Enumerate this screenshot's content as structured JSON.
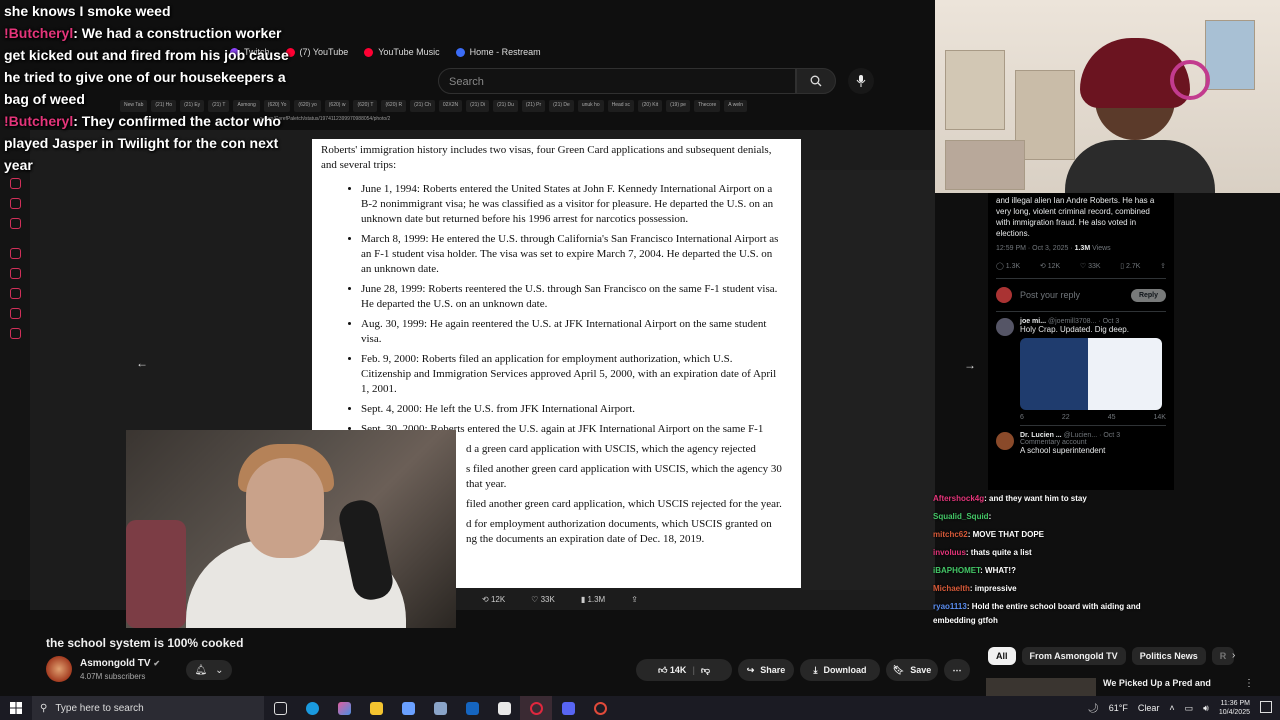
{
  "bookmarks": [
    {
      "label": "Twitch",
      "color": "#9146ff"
    },
    {
      "label": "(7) YouTube",
      "color": "#ff0033"
    },
    {
      "label": "YouTube Music",
      "color": "#ff0033"
    },
    {
      "label": "Home - Restream",
      "color": "#3b6cf6"
    }
  ],
  "search": {
    "placeholder": "Search"
  },
  "browser_tabs": [
    "New Tab",
    "(21) Ho",
    "(21) Ey",
    "(21) T",
    "Asmong",
    "(620) Yo",
    "(620) yo",
    "(620) w",
    "(620) T",
    "(620) R",
    "(21) Ch",
    "02X2N",
    "(21) Di",
    "(21) Du",
    "(21) Pr",
    "(21) De",
    "unuk ho",
    "Head sc",
    "(20) Kit",
    "(19) pe",
    "Thecore",
    "A weln"
  ],
  "url": "x.com/CarefPaletch/status/1974112399970988054/photo/2",
  "stream_chat": [
    {
      "user": "",
      "message": "she knows I smoke weed"
    },
    {
      "user": "!Butcheryl",
      "message": "We had a construction worker get kicked out and fired from his job cause he tried to give one of our housekeepers a bag of weed"
    },
    {
      "user": "!Butcheryl",
      "message": "They confirmed the actor who played Jasper in Twilight for the con next year"
    }
  ],
  "document": {
    "intro": "Roberts' immigration history includes two visas, four Green Card applications and subsequent denials, and several trips:",
    "items": [
      "June 1, 1994: Roberts entered the United States at John F. Kennedy International Airport on a B-2 nonimmigrant visa; he was classified as a visitor for pleasure. He departed the U.S. on an unknown date but returned before his 1996 arrest for narcotics possession.",
      "March 8, 1999: He entered the U.S. through California's San Francisco International Airport as an F-1 student visa holder. The visa was set to expire March 7, 2004. He departed the U.S. on an unknown date.",
      "June 28, 1999: Roberts reentered the U.S. through San Francisco on the same F-1 student visa. He departed the U.S. on an unknown date.",
      "Aug. 30, 1999: He again reentered the U.S. at JFK International Airport on the same student visa.",
      "Feb. 9, 2000: Roberts filed an application for employment authorization, which U.S. Citizenship and Immigration Services approved April 5, 2000, with an expiration date of April 1, 2001.",
      "Sept. 4, 2000: He left the U.S. from JFK International Airport.",
      "Sept. 30, 2000: Roberts entered the U.S. again at JFK International Airport on the same F-1",
      "d a green card application with USCIS, which the agency rejected",
      "s filed another green card application with USCIS, which the agency 30 that year.",
      "filed another green card application, which USCIS rejected for the year.",
      "d for employment authorization documents, which USCIS granted on ng the documents an expiration date of Dec. 18, 2019."
    ]
  },
  "doc_footer": {
    "retweets": "12K",
    "likes": "33K",
    "views": "1.3M"
  },
  "tweet": {
    "text": "and illegal alien Ian Andre Roberts. He has a very long, violent criminal record, combined with immigration fraud. He also voted in elections.",
    "time": "12:59 PM · Oct 3, 2025 · ",
    "views": "1.3M",
    "views_label": " Views",
    "actions": [
      "1.3K",
      "12K",
      "33K",
      "2.7K",
      ""
    ],
    "reply_placeholder": "Post your reply",
    "reply_button": "Reply",
    "reply1": {
      "name": "joe mi...",
      "handle": "@joemill3708... · Oct 3",
      "text": "Holy Crap. Updated. Dig deep.",
      "actions": [
        "6",
        "22",
        "45",
        "14K"
      ]
    },
    "reply2": {
      "name": "Dr. Lucien ...",
      "handle": "@Lucien... · Oct 3",
      "note": "Commentary account",
      "text": "A school superintendent"
    }
  },
  "chat_right": [
    {
      "user": "Aftershock4g",
      "message": "and they want him to stay"
    },
    {
      "user": "Squalid_Squid",
      "message": ""
    },
    {
      "user": "mitchc62",
      "message": "MOVE THAT DOPE"
    },
    {
      "user": "involuus",
      "message": "thats quite a list"
    },
    {
      "user": "iBAPHOMET",
      "message": "WHAT!?"
    },
    {
      "user": "Michaelth",
      "message": "impressive"
    },
    {
      "user": "ryao1113",
      "message": "Hold the entire school board with aiding and embedding gtfoh"
    }
  ],
  "video": {
    "title": "the school system is 100% cooked",
    "channel": "Asmongold TV",
    "subscribers": "4.07M subscribers",
    "likes": "14K",
    "share": "Share",
    "download": "Download",
    "save": "Save"
  },
  "chips": [
    "All",
    "From Asmongold TV",
    "Politics News",
    "R"
  ],
  "recommended": {
    "title": "We Picked Up a Pred and Brought Him to Our Sting"
  },
  "taskbar": {
    "search_placeholder": "Type here to search",
    "weather": "61°F",
    "weather_cond": "Clear",
    "time": "11:36 PM",
    "date": "10/4/2025"
  }
}
